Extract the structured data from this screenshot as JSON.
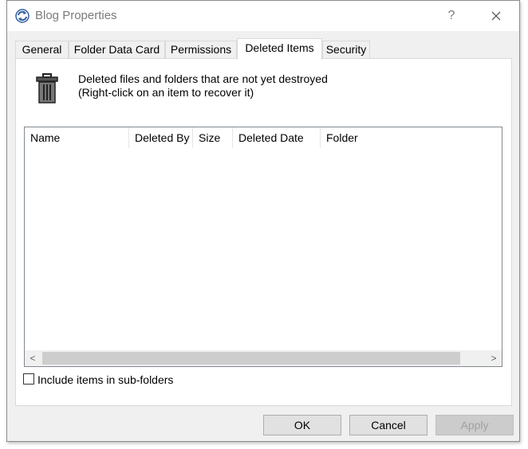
{
  "window": {
    "title": "Blog Properties",
    "help_label": "?",
    "app_icon": "folder-sync-icon",
    "close_icon": "close-icon"
  },
  "tabs": [
    {
      "label": "General",
      "active": false
    },
    {
      "label": "Folder Data Card",
      "active": false
    },
    {
      "label": "Permissions",
      "active": false
    },
    {
      "label": "Deleted Items",
      "active": true
    },
    {
      "label": "Security",
      "active": false
    }
  ],
  "deleted_items": {
    "icon": "trash-can-icon",
    "description_line1": "Deleted files and folders that are not yet destroyed",
    "description_line2": "(Right-click on an item to recover it)",
    "columns": [
      "Name",
      "Deleted By",
      "Size",
      "Deleted Date",
      "Folder"
    ],
    "rows": [],
    "include_subfolders_label": "Include items in sub-folders",
    "include_subfolders_checked": false
  },
  "buttons": {
    "ok": "OK",
    "cancel": "Cancel",
    "apply": "Apply",
    "apply_enabled": false
  },
  "scrollbar": {
    "left_arrow": "<",
    "right_arrow": ">"
  }
}
